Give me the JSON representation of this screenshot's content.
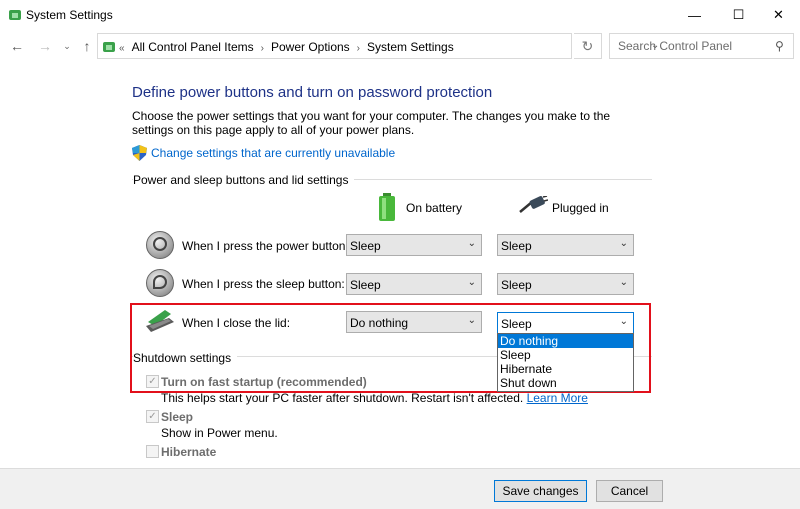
{
  "window": {
    "title": "System Settings",
    "controls": {
      "minimize": "—",
      "maximize": "☐",
      "close": "✕"
    }
  },
  "navbar": {
    "breadcrumbs": [
      "All Control Panel Items",
      "Power Options",
      "System Settings"
    ],
    "search_placeholder": "Search Control Panel"
  },
  "page": {
    "title": "Define power buttons and turn on password protection",
    "description": "Choose the power settings that you want for your computer. The changes you make to the settings on this page apply to all of your power plans.",
    "change_link": "Change settings that are currently unavailable"
  },
  "power_section": {
    "label": "Power and sleep buttons and lid settings",
    "columns": {
      "battery": "On battery",
      "plugged": "Plugged in"
    },
    "rows": [
      {
        "label": "When I press the power button:",
        "battery": "Sleep",
        "plugged": "Sleep"
      },
      {
        "label": "When I press the sleep button:",
        "battery": "Sleep",
        "plugged": "Sleep"
      },
      {
        "label": "When I close the lid:",
        "battery": "Do nothing",
        "plugged": "Sleep"
      }
    ],
    "lid_options": [
      "Do nothing",
      "Sleep",
      "Hibernate",
      "Shut down"
    ],
    "lid_highlighted_option": "Do nothing"
  },
  "shutdown_section": {
    "label": "Shutdown settings",
    "fast_startup": {
      "label": "Turn on fast startup (recommended)",
      "description": "This helps start your PC faster after shutdown. Restart isn't affected.",
      "link": "Learn More",
      "checked": true
    },
    "sleep": {
      "label": "Sleep",
      "description": "Show in Power menu.",
      "checked": true
    },
    "hibernate": {
      "label": "Hibernate",
      "checked": false
    }
  },
  "buttons": {
    "save": "Save changes",
    "cancel": "Cancel"
  },
  "colors": {
    "title_blue": "#1e3287",
    "link_blue": "#0066cc",
    "highlight_red": "#e2101b",
    "select_blue": "#0078d7"
  }
}
